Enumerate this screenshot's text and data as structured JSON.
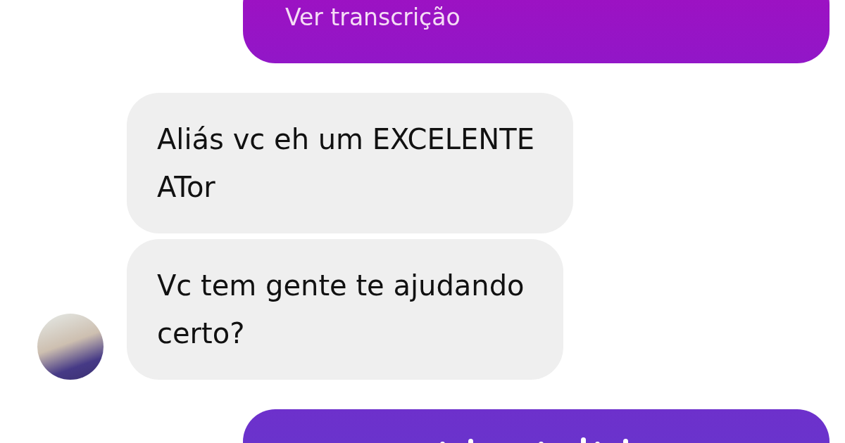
{
  "messages": [
    {
      "kind": "sent_transcript",
      "link": "Ver transcrição"
    },
    {
      "kind": "received",
      "lines": [
        "Aliás vc eh um EXCELENTE",
        "ATor"
      ],
      "show_avatar": false
    },
    {
      "kind": "received",
      "lines": [
        "Vc tem gente te ajudando",
        "certo?"
      ],
      "show_avatar": true
    },
    {
      "kind": "sent_audio"
    }
  ]
}
